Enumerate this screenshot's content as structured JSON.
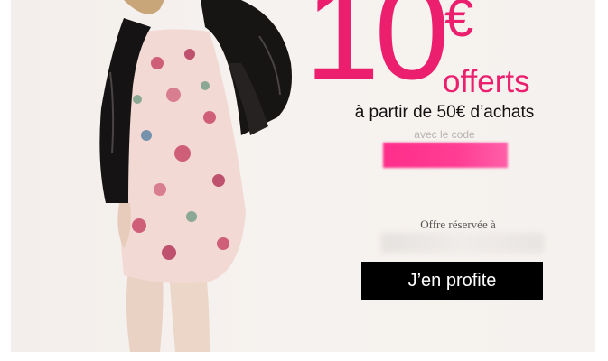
{
  "promo": {
    "amount": "10",
    "currency": "€",
    "offerts": "offerts",
    "condition": "à partir de 50€ d’achats",
    "code_label": "avec le code",
    "brand_color": "#ec1f6f"
  },
  "reservation": {
    "label": "Offre réservée à"
  },
  "cta": {
    "label": "J’en profite"
  },
  "colors": {
    "background": "#f4efec",
    "button": "#000000",
    "accent": "#ec1f6f"
  }
}
